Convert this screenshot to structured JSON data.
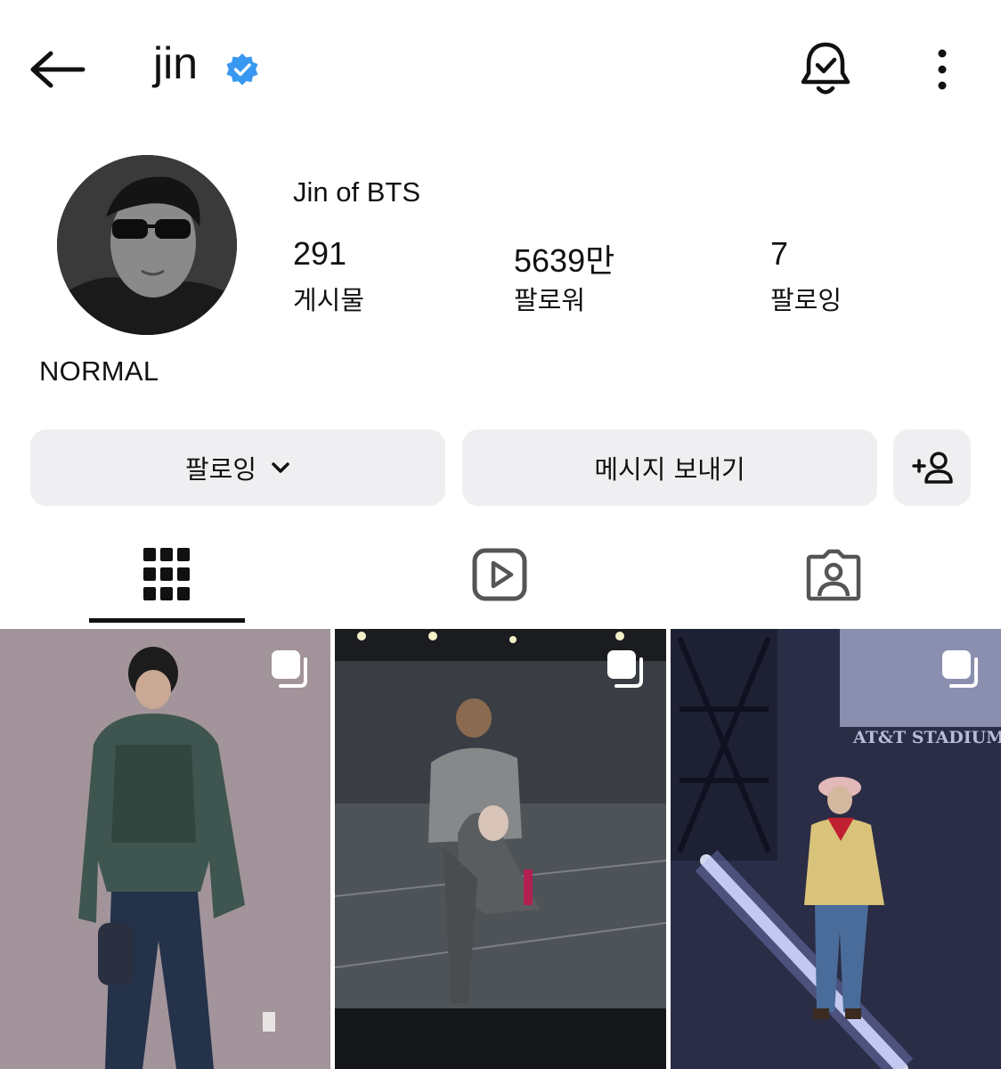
{
  "header": {
    "username": "jin",
    "back_icon": "arrow-left-icon",
    "verified_icon": "verified-badge-icon",
    "notification_icon": "bell-check-icon",
    "more_icon": "more-vertical-icon",
    "accent_color": "#3897f0"
  },
  "profile": {
    "display_name": "Jin of BTS",
    "bio": "NORMAL",
    "stats": [
      {
        "value": "291",
        "label": "게시물"
      },
      {
        "value": "5639만",
        "label": "팔로워"
      },
      {
        "value": "7",
        "label": "팔로잉"
      }
    ]
  },
  "actions": {
    "follow_label": "팔로잉",
    "message_label": "메시지 보내기",
    "add_user_icon": "add-person-icon"
  },
  "tabs": [
    {
      "name": "grid",
      "icon": "grid-icon",
      "active": true
    },
    {
      "name": "reels",
      "icon": "reels-icon",
      "active": false
    },
    {
      "name": "tagged",
      "icon": "tagged-person-icon",
      "active": false
    }
  ],
  "posts": [
    {
      "type": "carousel",
      "icon": "carousel-icon"
    },
    {
      "type": "carousel",
      "icon": "carousel-icon"
    },
    {
      "type": "carousel",
      "icon": "carousel-icon",
      "sign_text": "AT&T STADIUM"
    }
  ]
}
